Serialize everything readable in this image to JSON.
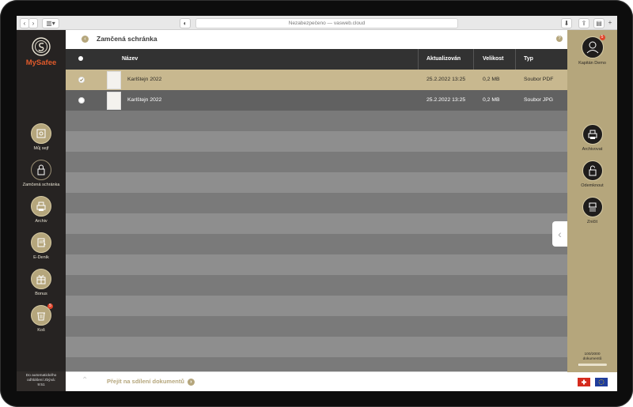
{
  "browser": {
    "url": "Nezabezpečeno — vasweb.cloud"
  },
  "app": {
    "name": "MySafee"
  },
  "sidebar": {
    "items": [
      {
        "label": "Můj sejf",
        "icon": "safe-icon"
      },
      {
        "label": "Zamčená schránka",
        "icon": "lock-icon"
      },
      {
        "label": "Archiv",
        "icon": "printer-icon"
      },
      {
        "label": "E-Deník",
        "icon": "notebook-icon"
      },
      {
        "label": "Bonus",
        "icon": "gift-icon"
      },
      {
        "label": "Koš",
        "icon": "trash-icon",
        "badge": "5"
      }
    ],
    "footer": [
      "Do automatického",
      "odhlášení zbývá:",
      "9:51"
    ]
  },
  "header": {
    "title": "Zamčená schránka",
    "help": "?"
  },
  "table": {
    "columns": [
      "Název",
      "Aktualizován",
      "Velikost",
      "Typ"
    ],
    "rows": [
      {
        "name": "Karlštejn 2022",
        "updated": "25.2.2022 13:25",
        "size": "0,2 MB",
        "type": "Soubor PDF",
        "selected": true
      },
      {
        "name": "Karlštejn 2022",
        "updated": "25.2.2022 13:25",
        "size": "0,2 MB",
        "type": "Soubor JPG",
        "selected": false
      }
    ]
  },
  "footer": {
    "link": "Přejít na sdílení dokumentů"
  },
  "rightpanel": {
    "user": {
      "name": "Kapitán Demo",
      "badge": "5"
    },
    "actions": [
      {
        "label": "Archivovat",
        "icon": "archive-icon"
      },
      {
        "label": "Odemknout",
        "icon": "unlock-icon"
      },
      {
        "label": "Zničit",
        "icon": "shredder-icon"
      }
    ],
    "quota": {
      "text1": "100/2000",
      "text2": "dokumentů",
      "fraction": 0.05
    }
  },
  "colors": {
    "accent": "#b5a67c",
    "sidebar": "#262322",
    "logo": "#e05a2b",
    "header_row": "#323232"
  }
}
